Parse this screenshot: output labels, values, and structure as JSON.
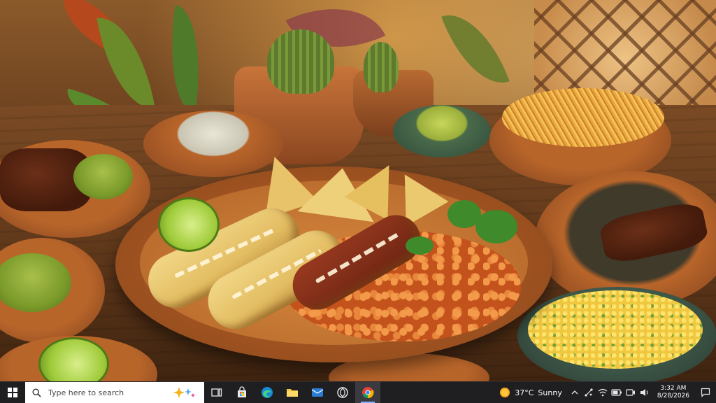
{
  "desktop": {
    "wallpaper": "mexican-food-table-photo"
  },
  "taskbar": {
    "search": {
      "placeholder": "Type here to search"
    },
    "pinned_apps": [
      {
        "icon": "task-view-icon"
      },
      {
        "icon": "microsoft-store-icon"
      },
      {
        "icon": "edge-icon"
      },
      {
        "icon": "file-explorer-icon"
      },
      {
        "icon": "mail-icon"
      },
      {
        "icon": "chatgpt-icon"
      },
      {
        "icon": "chrome-icon"
      }
    ],
    "weather": {
      "temperature": "37°C",
      "condition": "Sunny"
    },
    "tray_icons": [
      "chevron-up-icon",
      "network-icon",
      "wifi-icon",
      "battery-icon",
      "webcam-icon",
      "speaker-icon"
    ],
    "clock": {
      "time": "3:32 AM",
      "date": "8/28/2026"
    },
    "colors": {
      "taskbar_bg": "#1f1f22",
      "active_indicator": "#7fb2ff"
    }
  }
}
